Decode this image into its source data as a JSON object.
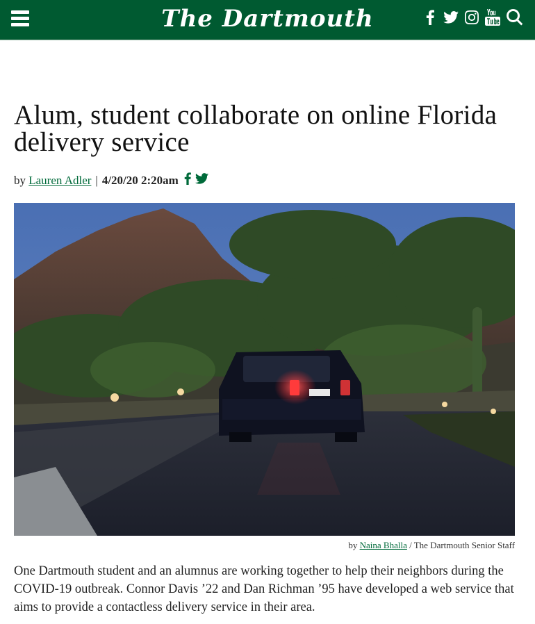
{
  "header": {
    "brand": "The Dartmouth",
    "menu_icon": "hamburger-menu-icon",
    "social_icons": [
      "facebook-icon",
      "twitter-icon",
      "instagram-icon",
      "youtube-icon",
      "search-icon"
    ]
  },
  "article": {
    "headline": "Alum, student collaborate on online Florida delivery service",
    "byline_prefix": "by",
    "author": "Lauren Adler",
    "separator": "|",
    "date": "4/20/20 2:20am",
    "photo_credit": {
      "prefix": "by",
      "photographer": "Naina Bhalla",
      "suffix": "/ The Dartmouth Senior Staff"
    },
    "body": "One Dartmouth student and an alumnus are working together to help their neighbors during the COVID-19 outbreak. Connor Davis ’22 and Dan Richman ’95 have developed a web service that aims to provide a contactless delivery service in their area."
  },
  "colors": {
    "brand_green": "#005a31",
    "link_green": "#006a3a"
  }
}
